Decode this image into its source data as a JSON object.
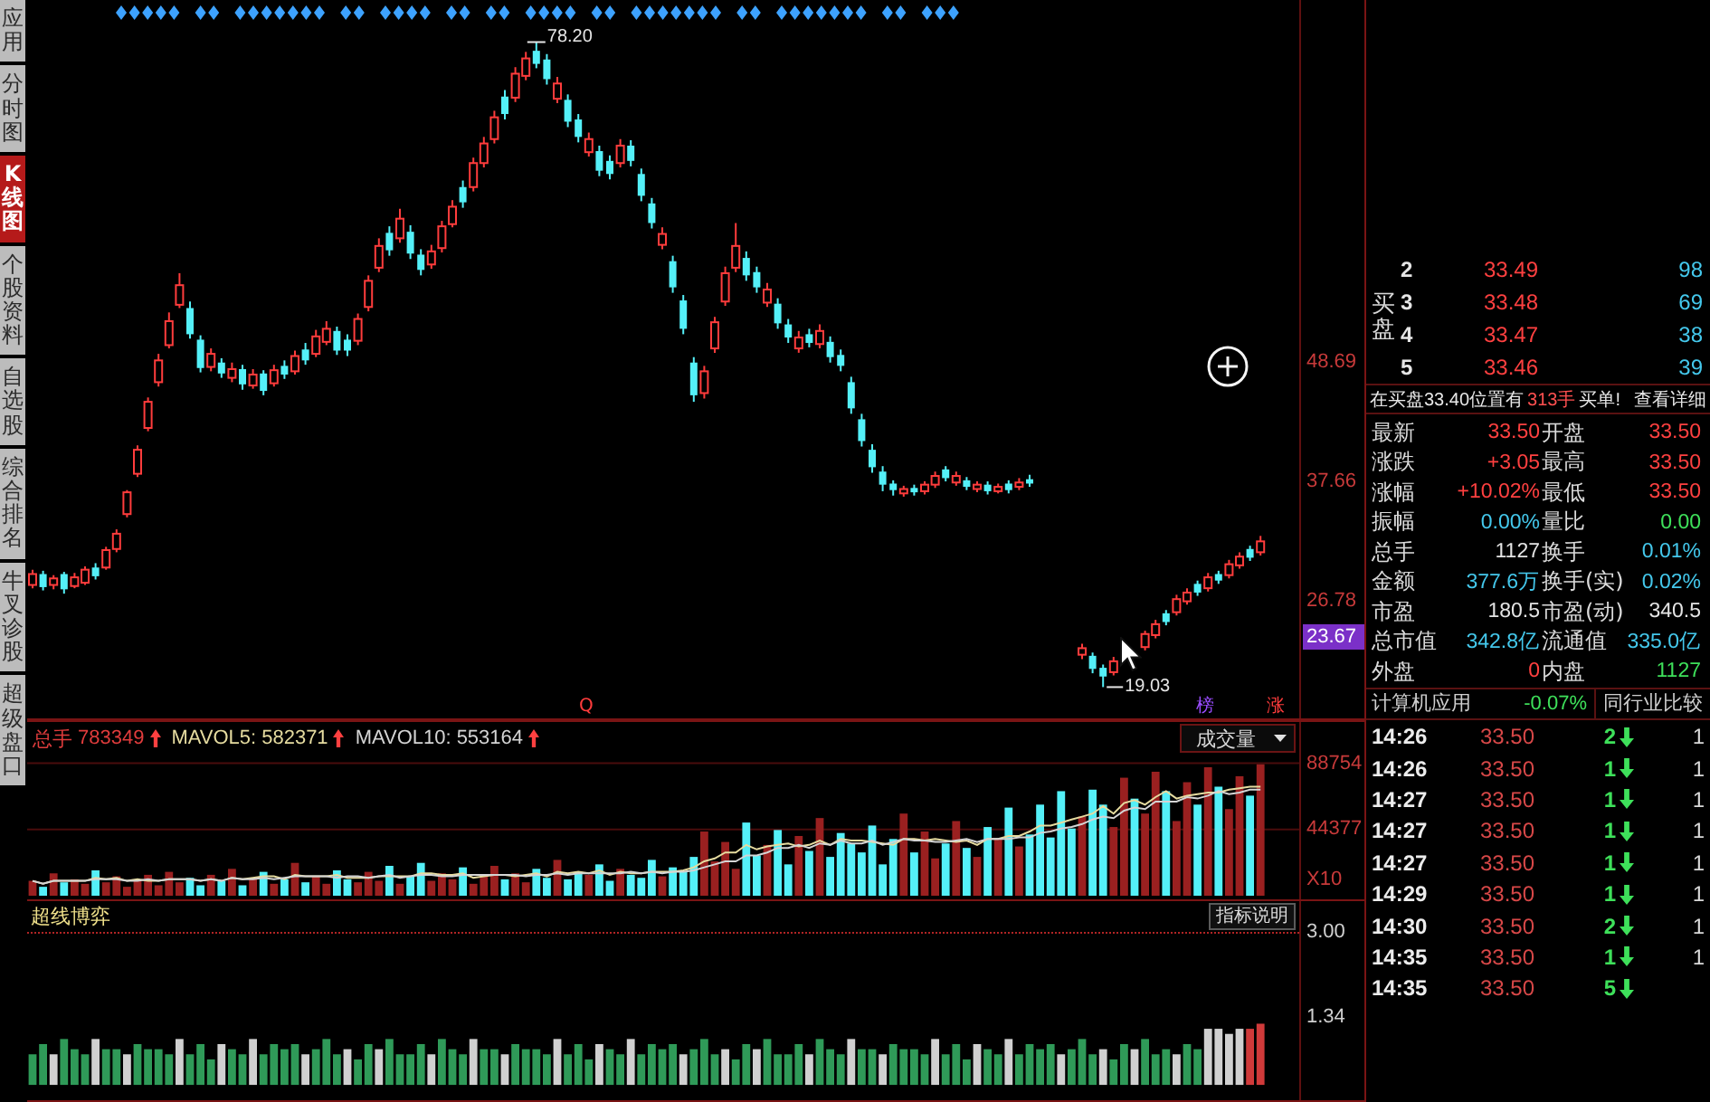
{
  "sidebar": {
    "tabs": [
      {
        "label": "应用",
        "selected": false
      },
      {
        "label": "分时图",
        "selected": false
      },
      {
        "label": "K线图",
        "selected": true
      },
      {
        "label": "个股资料",
        "selected": false
      },
      {
        "label": "自选股",
        "selected": false
      },
      {
        "label": "综合排名",
        "selected": false
      },
      {
        "label": "牛叉诊股",
        "selected": false
      },
      {
        "label": "超级盘口",
        "selected": false
      }
    ]
  },
  "price_chart": {
    "high_label": "78.20",
    "low_label": "19.03",
    "markers": [
      {
        "text": "Q",
        "color": "#ff3c3c"
      },
      {
        "text": "榜",
        "color": "#9a4cff"
      },
      {
        "text": "涨",
        "color": "#ff3c3c"
      }
    ],
    "current_tag": "23.67",
    "chart_data": {
      "type": "candlestick",
      "ylim": [
        16.16,
        82.06
      ],
      "yticks": [
        {
          "value": 48.69,
          "label": "48.69"
        },
        {
          "value": 37.66,
          "label": "37.66"
        },
        {
          "value": 26.78,
          "label": "26.78"
        }
      ],
      "ohlc": [
        [
          28.4,
          29.8,
          28.1,
          29.4
        ],
        [
          29.4,
          29.7,
          27.9,
          28.2
        ],
        [
          28.4,
          29.3,
          28.0,
          29.0
        ],
        [
          29.4,
          29.6,
          27.6,
          28.0
        ],
        [
          28.3,
          29.5,
          28.1,
          29.1
        ],
        [
          28.6,
          30.1,
          28.4,
          29.8
        ],
        [
          30.0,
          30.4,
          28.9,
          29.2
        ],
        [
          30.0,
          31.9,
          29.8,
          31.6
        ],
        [
          31.7,
          33.5,
          31.4,
          33.1
        ],
        [
          34.9,
          37.1,
          34.6,
          36.9
        ],
        [
          38.6,
          41.2,
          38.3,
          40.8
        ],
        [
          42.8,
          45.6,
          42.5,
          45.2
        ],
        [
          47.0,
          49.6,
          46.6,
          49.0
        ],
        [
          50.4,
          53.4,
          50.1,
          52.6
        ],
        [
          54.1,
          57.0,
          53.8,
          55.9
        ],
        [
          53.8,
          54.4,
          51.0,
          51.4
        ],
        [
          50.9,
          51.3,
          47.9,
          48.3
        ],
        [
          48.4,
          50.1,
          48.0,
          49.6
        ],
        [
          48.8,
          49.2,
          47.4,
          47.8
        ],
        [
          47.4,
          48.8,
          47.0,
          48.2
        ],
        [
          48.2,
          48.6,
          46.3,
          46.8
        ],
        [
          46.7,
          48.2,
          46.4,
          47.7
        ],
        [
          47.8,
          48.1,
          45.8,
          46.2
        ],
        [
          46.9,
          48.6,
          46.6,
          48.1
        ],
        [
          48.5,
          49.0,
          47.3,
          47.7
        ],
        [
          48.0,
          49.9,
          47.7,
          49.4
        ],
        [
          50.0,
          50.6,
          48.6,
          49.0
        ],
        [
          49.6,
          51.8,
          49.3,
          51.2
        ],
        [
          50.7,
          52.6,
          50.4,
          51.9
        ],
        [
          51.7,
          52.1,
          49.5,
          49.9
        ],
        [
          50.9,
          51.4,
          49.4,
          49.9
        ],
        [
          50.8,
          53.3,
          50.4,
          52.8
        ],
        [
          53.9,
          56.8,
          53.5,
          56.3
        ],
        [
          57.5,
          60.2,
          57.1,
          59.5
        ],
        [
          60.7,
          61.3,
          58.6,
          59.1
        ],
        [
          60.2,
          62.9,
          59.8,
          62.0
        ],
        [
          60.8,
          61.4,
          58.3,
          58.8
        ],
        [
          58.7,
          59.2,
          56.8,
          57.3
        ],
        [
          57.8,
          59.6,
          57.4,
          59.0
        ],
        [
          59.3,
          61.8,
          58.9,
          61.3
        ],
        [
          61.5,
          63.7,
          61.2,
          63.1
        ],
        [
          64.9,
          65.5,
          63.0,
          63.5
        ],
        [
          64.9,
          67.6,
          64.5,
          67.1
        ],
        [
          67.1,
          69.5,
          66.7,
          68.9
        ],
        [
          69.3,
          71.9,
          68.9,
          71.3
        ],
        [
          73.2,
          73.8,
          71.1,
          71.6
        ],
        [
          73.1,
          75.9,
          72.7,
          75.3
        ],
        [
          75.1,
          77.3,
          74.7,
          76.7
        ],
        [
          77.4,
          78.2,
          75.8,
          76.2
        ],
        [
          76.6,
          77.1,
          74.3,
          74.8
        ],
        [
          73.0,
          75.0,
          72.6,
          74.4
        ],
        [
          72.9,
          73.4,
          70.4,
          70.9
        ],
        [
          71.1,
          71.6,
          69.0,
          69.5
        ],
        [
          68.1,
          69.9,
          67.7,
          69.3
        ],
        [
          68.2,
          68.7,
          65.9,
          66.4
        ],
        [
          67.3,
          67.8,
          65.6,
          66.1
        ],
        [
          67.1,
          69.3,
          66.7,
          68.7
        ],
        [
          68.7,
          69.2,
          66.8,
          67.3
        ],
        [
          66.1,
          66.6,
          63.6,
          64.1
        ],
        [
          63.4,
          63.9,
          61.1,
          61.6
        ],
        [
          59.6,
          61.2,
          59.2,
          60.6
        ],
        [
          58.1,
          58.6,
          55.2,
          55.7
        ],
        [
          54.5,
          55.0,
          51.4,
          51.9
        ],
        [
          48.8,
          49.3,
          45.2,
          45.8
        ],
        [
          46.0,
          48.5,
          45.5,
          48.0
        ],
        [
          50.1,
          53.0,
          49.7,
          52.5
        ],
        [
          54.4,
          57.6,
          54.0,
          57.0
        ],
        [
          57.5,
          61.6,
          57.1,
          59.5
        ],
        [
          58.4,
          59.0,
          56.3,
          56.8
        ],
        [
          57.1,
          57.6,
          55.2,
          55.7
        ],
        [
          54.3,
          56.1,
          53.9,
          55.5
        ],
        [
          54.2,
          54.7,
          51.9,
          52.4
        ],
        [
          52.3,
          52.8,
          50.6,
          51.1
        ],
        [
          50.1,
          51.7,
          49.7,
          51.1
        ],
        [
          51.4,
          51.9,
          50.2,
          50.6
        ],
        [
          50.5,
          52.3,
          50.1,
          51.7
        ],
        [
          50.7,
          51.2,
          48.8,
          49.3
        ],
        [
          49.5,
          50.0,
          48.0,
          48.5
        ],
        [
          47.0,
          47.5,
          44.1,
          44.6
        ],
        [
          43.6,
          44.1,
          41.1,
          41.6
        ],
        [
          40.8,
          41.3,
          38.7,
          39.2
        ],
        [
          38.8,
          39.3,
          37.0,
          37.6
        ],
        [
          37.7,
          38.0,
          36.6,
          37.1
        ],
        [
          36.8,
          37.5,
          36.5,
          37.2
        ],
        [
          37.3,
          37.6,
          36.6,
          36.9
        ],
        [
          37.0,
          37.9,
          36.7,
          37.6
        ],
        [
          37.6,
          38.8,
          37.3,
          38.4
        ],
        [
          39.0,
          39.3,
          37.9,
          38.2
        ],
        [
          37.8,
          38.8,
          37.5,
          38.4
        ],
        [
          38.0,
          38.3,
          37.1,
          37.4
        ],
        [
          37.2,
          37.9,
          36.9,
          37.6
        ],
        [
          37.6,
          37.9,
          36.7,
          37.0
        ],
        [
          37.0,
          37.7,
          36.8,
          37.4
        ],
        [
          37.7,
          38.0,
          36.8,
          37.1
        ],
        [
          37.4,
          38.2,
          37.1,
          37.8
        ],
        [
          38.1,
          38.5,
          37.4,
          37.7
        ],
        null,
        null,
        null,
        null,
        [
          22.0,
          23.0,
          21.6,
          22.6
        ],
        [
          21.9,
          22.2,
          20.3,
          20.7
        ],
        [
          20.8,
          21.1,
          19.03,
          20.0
        ],
        [
          20.4,
          21.8,
          20.1,
          21.4
        ],
        null,
        null,
        [
          22.7,
          24.2,
          22.4,
          23.9
        ],
        [
          23.8,
          25.2,
          23.5,
          24.8
        ],
        [
          25.8,
          26.1,
          24.7,
          25.0
        ],
        [
          25.9,
          27.5,
          25.6,
          27.1
        ],
        [
          26.9,
          28.1,
          26.6,
          27.7
        ],
        [
          28.5,
          28.8,
          27.4,
          27.7
        ],
        [
          28.1,
          29.5,
          27.8,
          29.1
        ],
        [
          29.4,
          29.7,
          28.5,
          28.8
        ],
        [
          29.3,
          30.7,
          29.0,
          30.3
        ],
        [
          30.2,
          31.4,
          29.9,
          31.0
        ],
        [
          31.7,
          32.0,
          30.6,
          30.9
        ],
        [
          31.4,
          32.9,
          31.1,
          32.4
        ]
      ]
    }
  },
  "volume_panel": {
    "stats": [
      {
        "label": "总手",
        "value": "783349",
        "up": true,
        "color": "#e03c3c"
      },
      {
        "label": "MAVOL5:",
        "value": "582371",
        "up": true,
        "color": "#e6dca0"
      },
      {
        "label": "MAVOL10:",
        "value": "553164",
        "up": true,
        "color": "#d4d4d4"
      }
    ],
    "selector": "成交量",
    "axis_unit": "X10",
    "chart_data": {
      "type": "bar",
      "ylim": [
        -2400,
        117500
      ],
      "yticks": [
        {
          "value": 88754,
          "label": "88754"
        },
        {
          "value": 44377,
          "label": "44377"
        }
      ],
      "series": [
        {
          "type": "bar",
          "values": [
            10000,
            6000,
            15000,
            9000,
            11000,
            8000,
            17000,
            9000,
            13000,
            6000,
            10000,
            14000,
            7000,
            16000,
            9000,
            12000,
            7000,
            14000,
            10000,
            18000,
            7000,
            12000,
            16000,
            8000,
            11000,
            22000,
            9000,
            13000,
            8000,
            17000,
            11000,
            9000,
            16000,
            10000,
            20000,
            8000,
            13000,
            22000,
            10000,
            15000,
            11000,
            19000,
            8000,
            13000,
            20000,
            11000,
            15000,
            9000,
            18000,
            12000,
            24000,
            11000,
            16000,
            14000,
            21000,
            10000,
            18000,
            14000,
            12000,
            24000,
            13000,
            19000,
            16000,
            26000,
            43000,
            23000,
            36000,
            18000,
            49000,
            27000,
            34000,
            44000,
            21000,
            40000,
            30000,
            52000,
            26000,
            42000,
            35000,
            29000,
            47000,
            21000,
            38000,
            55000,
            29000,
            43000,
            25000,
            35000,
            50000,
            32000,
            26000,
            46000,
            38000,
            59000,
            33000,
            41000,
            61000,
            39000,
            70000,
            45000,
            53000,
            71000,
            61000,
            46000,
            79000,
            65000,
            55000,
            83000,
            70000,
            50000,
            76000,
            61000,
            86000,
            73000,
            58000,
            80000,
            67000,
            88000
          ],
          "colors": [
            "#9a2020",
            "#54f0f8",
            "#9a2020",
            "#54f0f8",
            "#9a2020",
            "#9a2020",
            "#54f0f8",
            "#9a2020",
            "#9a2020",
            "#9a2020",
            "#9a2020",
            "#9a2020",
            "#9a2020",
            "#9a2020",
            "#9a2020",
            "#54f0f8",
            "#54f0f8",
            "#9a2020",
            "#54f0f8",
            "#9a2020",
            "#54f0f8",
            "#9a2020",
            "#54f0f8",
            "#9a2020",
            "#54f0f8",
            "#9a2020",
            "#54f0f8",
            "#9a2020",
            "#9a2020",
            "#54f0f8",
            "#54f0f8",
            "#9a2020",
            "#9a2020",
            "#9a2020",
            "#54f0f8",
            "#9a2020",
            "#54f0f8",
            "#54f0f8",
            "#9a2020",
            "#9a2020",
            "#9a2020",
            "#54f0f8",
            "#9a2020",
            "#9a2020",
            "#9a2020",
            "#54f0f8",
            "#9a2020",
            "#9a2020",
            "#54f0f8",
            "#54f0f8",
            "#9a2020",
            "#54f0f8",
            "#54f0f8",
            "#9a2020",
            "#54f0f8",
            "#54f0f8",
            "#9a2020",
            "#54f0f8",
            "#54f0f8",
            "#54f0f8",
            "#9a2020",
            "#54f0f8",
            "#54f0f8",
            "#54f0f8",
            "#9a2020",
            "#9a2020",
            "#9a2020",
            "#9a2020",
            "#54f0f8",
            "#54f0f8",
            "#9a2020",
            "#54f0f8",
            "#54f0f8",
            "#9a2020",
            "#54f0f8",
            "#9a2020",
            "#54f0f8",
            "#54f0f8",
            "#54f0f8",
            "#54f0f8",
            "#54f0f8",
            "#54f0f8",
            "#54f0f8",
            "#9a2020",
            "#54f0f8",
            "#9a2020",
            "#9a2020",
            "#54f0f8",
            "#9a2020",
            "#54f0f8",
            "#9a2020",
            "#54f0f8",
            "#9a2020",
            "#54f0f8",
            "#9a2020",
            "#54f0f8",
            "#54f0f8",
            "#54f0f8",
            "#54f0f8",
            "#54f0f8",
            "#9a2020",
            "#54f0f8",
            "#54f0f8",
            "#9a2020",
            "#9a2020",
            "#54f0f8",
            "#9a2020",
            "#9a2020",
            "#54f0f8",
            "#9a2020",
            "#9a2020",
            "#54f0f8",
            "#9a2020",
            "#54f0f8",
            "#9a2020",
            "#9a2020",
            "#54f0f8",
            "#9a2020"
          ]
        },
        {
          "type": "line",
          "color": "#e6dca0",
          "values": [
            10000,
            8000,
            10000,
            10000,
            10000,
            10000,
            12000,
            11000,
            12000,
            10000,
            11000,
            10000,
            10000,
            11000,
            11000,
            11000,
            10000,
            11000,
            10000,
            12000,
            11000,
            12000,
            13000,
            13000,
            11000,
            14000,
            13000,
            13000,
            13000,
            14000,
            12000,
            12000,
            12000,
            13000,
            13000,
            13000,
            13000,
            15000,
            15000,
            14000,
            14000,
            15000,
            12000,
            13000,
            14000,
            14000,
            13000,
            14000,
            15000,
            13000,
            16000,
            15000,
            16000,
            15000,
            17000,
            14000,
            16000,
            15000,
            15000,
            16000,
            16000,
            16000,
            17000,
            19000,
            23000,
            25000,
            29000,
            29000,
            34000,
            31000,
            33000,
            34000,
            35000,
            33000,
            34000,
            37000,
            34000,
            38000,
            37000,
            37000,
            36000,
            35000,
            34000,
            38000,
            38000,
            37000,
            38000,
            37000,
            36000,
            37000,
            34000,
            38000,
            38000,
            40000,
            40000,
            43000,
            47000,
            47000,
            49000,
            51000,
            53000,
            55000,
            60000,
            55000,
            62000,
            64000,
            61000,
            66000,
            70000,
            65000,
            67000,
            68000,
            69000,
            69000,
            71000,
            72000,
            73000,
            73000
          ]
        },
        {
          "type": "line",
          "color": "#d4d4d4",
          "values": [
            10000,
            8000,
            10000,
            10000,
            10000,
            10000,
            11000,
            11000,
            11000,
            10000,
            10000,
            11000,
            10000,
            11000,
            11000,
            11000,
            10000,
            11000,
            10000,
            12000,
            11000,
            11000,
            12000,
            11000,
            12000,
            13000,
            13000,
            13000,
            13000,
            12000,
            13000,
            13000,
            12000,
            13000,
            14000,
            12000,
            13000,
            14000,
            14000,
            13000,
            13000,
            14000,
            14000,
            14000,
            14000,
            14000,
            14000,
            13000,
            14000,
            14000,
            15000,
            14000,
            15000,
            15000,
            15000,
            15000,
            15000,
            16000,
            15000,
            16000,
            15000,
            16000,
            16000,
            17000,
            19000,
            21000,
            23000,
            23000,
            27000,
            27000,
            29000,
            32000,
            32000,
            34000,
            32000,
            35000,
            34000,
            37000,
            35000,
            35000,
            37000,
            34000,
            36000,
            38000,
            37000,
            37000,
            36000,
            36000,
            37000,
            38000,
            36000,
            38000,
            38000,
            38000,
            39000,
            39000,
            42000,
            43000,
            45000,
            46000,
            48000,
            51000,
            53000,
            52000,
            57000,
            59000,
            58000,
            63000,
            63000,
            63000,
            66000,
            65000,
            67000,
            70000,
            68000,
            69000,
            71000,
            71000
          ]
        }
      ]
    }
  },
  "indicator_panel": {
    "name": "超线博弈",
    "help_button": "指标说明",
    "chart_data": {
      "type": "bar",
      "ylim": [
        -0.3,
        3.0
      ],
      "yticks": [
        {
          "value": 3.0,
          "label": "3.00"
        },
        {
          "value": 1.34,
          "label": "1.34"
        }
      ],
      "series": [
        {
          "values": [
            0.6,
            0.8,
            0.6,
            0.9,
            0.7,
            0.6,
            0.9,
            0.7,
            0.7,
            0.6,
            0.8,
            0.7,
            0.7,
            0.6,
            0.9,
            0.6,
            0.8,
            0.5,
            0.8,
            0.7,
            0.6,
            0.9,
            0.6,
            0.8,
            0.7,
            0.8,
            0.6,
            0.7,
            0.9,
            0.6,
            0.7,
            0.5,
            0.8,
            0.7,
            0.9,
            0.6,
            0.6,
            0.8,
            0.6,
            0.9,
            0.7,
            0.6,
            0.9,
            0.7,
            0.7,
            0.6,
            0.8,
            0.7,
            0.7,
            0.6,
            0.9,
            0.6,
            0.8,
            0.5,
            0.8,
            0.7,
            0.6,
            0.9,
            0.6,
            0.8,
            0.7,
            0.8,
            0.6,
            0.7,
            0.9,
            0.6,
            0.7,
            0.5,
            0.8,
            0.7,
            0.9,
            0.6,
            0.6,
            0.8,
            0.6,
            0.9,
            0.7,
            0.6,
            0.9,
            0.7,
            0.7,
            0.6,
            0.8,
            0.7,
            0.7,
            0.6,
            0.9,
            0.6,
            0.8,
            0.5,
            0.8,
            0.7,
            0.6,
            0.9,
            0.6,
            0.8,
            0.7,
            0.8,
            0.6,
            0.7,
            0.9,
            0.6,
            0.7,
            0.5,
            0.8,
            0.7,
            0.9,
            0.6,
            0.7,
            0.6,
            0.8,
            0.7,
            1.1,
            1.1,
            1.0,
            1.1,
            1.1,
            1.2
          ],
          "colors": [
            "#2f9a58",
            "#2f9a58",
            "#d0d0d0",
            "#2f9a58",
            "#2f9a58",
            "#2f9a58",
            "#d0d0d0",
            "#2f9a58",
            "#2f9a58",
            "#d0d0d0",
            "#2f9a58",
            "#2f9a58",
            "#2f9a58",
            "#2f9a58",
            "#d0d0d0",
            "#2f9a58",
            "#2f9a58",
            "#2f9a58",
            "#d0d0d0",
            "#2f9a58",
            "#2f9a58",
            "#d0d0d0",
            "#2f9a58",
            "#2f9a58",
            "#2f9a58",
            "#2f9a58",
            "#d0d0d0",
            "#2f9a58",
            "#2f9a58",
            "#2f9a58",
            "#d0d0d0",
            "#2f9a58",
            "#2f9a58",
            "#d0d0d0",
            "#2f9a58",
            "#2f9a58",
            "#2f9a58",
            "#2f9a58",
            "#d0d0d0",
            "#2f9a58",
            "#2f9a58",
            "#2f9a58",
            "#d0d0d0",
            "#2f9a58",
            "#2f9a58",
            "#d0d0d0",
            "#2f9a58",
            "#2f9a58",
            "#2f9a58",
            "#2f9a58",
            "#d0d0d0",
            "#2f9a58",
            "#2f9a58",
            "#2f9a58",
            "#d0d0d0",
            "#2f9a58",
            "#2f9a58",
            "#d0d0d0",
            "#2f9a58",
            "#2f9a58",
            "#2f9a58",
            "#2f9a58",
            "#d0d0d0",
            "#2f9a58",
            "#2f9a58",
            "#2f9a58",
            "#d0d0d0",
            "#2f9a58",
            "#2f9a58",
            "#d0d0d0",
            "#2f9a58",
            "#2f9a58",
            "#2f9a58",
            "#2f9a58",
            "#d0d0d0",
            "#2f9a58",
            "#2f9a58",
            "#2f9a58",
            "#d0d0d0",
            "#2f9a58",
            "#2f9a58",
            "#d0d0d0",
            "#2f9a58",
            "#2f9a58",
            "#2f9a58",
            "#2f9a58",
            "#d0d0d0",
            "#2f9a58",
            "#2f9a58",
            "#2f9a58",
            "#d0d0d0",
            "#2f9a58",
            "#2f9a58",
            "#d0d0d0",
            "#2f9a58",
            "#2f9a58",
            "#2f9a58",
            "#2f9a58",
            "#d0d0d0",
            "#2f9a58",
            "#2f9a58",
            "#2f9a58",
            "#d0d0d0",
            "#2f9a58",
            "#2f9a58",
            "#d0d0d0",
            "#2f9a58",
            "#2f9a58",
            "#2f9a58",
            "#d0d0d0",
            "#2f9a58",
            "#2f9a58",
            "#d0d0d0",
            "#d0d0d0",
            "#d0d0d0",
            "#d0d0d0",
            "#d03a3a",
            "#d03a3a"
          ]
        }
      ]
    }
  },
  "order_book": {
    "side_label": "买盘",
    "rows": [
      {
        "rank": "2",
        "price": "33.49",
        "volume": "98"
      },
      {
        "rank": "3",
        "price": "33.48",
        "volume": "69"
      },
      {
        "rank": "4",
        "price": "33.47",
        "volume": "38"
      },
      {
        "rank": "5",
        "price": "33.46",
        "volume": "39"
      }
    ]
  },
  "order_notice": {
    "text": "在买盘33.40位置有",
    "lots": "313手",
    "suffix": "买单!",
    "link": "查看详细"
  },
  "quote": {
    "rows": [
      {
        "left": {
          "label": "最新",
          "value": "33.50",
          "color": "#ff4040"
        },
        "right": {
          "label": "开盘",
          "value": "33.50",
          "color": "#ff4040"
        }
      },
      {
        "left": {
          "label": "涨跌",
          "value": "+3.05",
          "color": "#ff4040"
        },
        "right": {
          "label": "最高",
          "value": "33.50",
          "color": "#ff4040"
        }
      },
      {
        "left": {
          "label": "涨幅",
          "value": "+10.02%",
          "color": "#ff4040"
        },
        "right": {
          "label": "最低",
          "value": "33.50",
          "color": "#ff4040"
        }
      },
      {
        "left": {
          "label": "振幅",
          "value": "0.00%",
          "color": "#44c8ec"
        },
        "right": {
          "label": "量比",
          "value": "0.00",
          "color": "#3ee05a"
        }
      },
      {
        "left": {
          "label": "总手",
          "value": "1127",
          "color": "#e4e4e4"
        },
        "right": {
          "label": "换手",
          "value": "0.01%",
          "color": "#44c8ec"
        }
      },
      {
        "left": {
          "label": "金额",
          "value": "377.6万",
          "color": "#44c8ec"
        },
        "right": {
          "label": "换手(实)",
          "value": "0.02%",
          "color": "#44c8ec"
        }
      },
      {
        "left": {
          "label": "市盈",
          "value": "180.5",
          "color": "#e4e4e4"
        },
        "right": {
          "label": "市盈(动)",
          "value": "340.5",
          "color": "#e4e4e4"
        }
      },
      {
        "left": {
          "label": "总市值",
          "value": "342.8亿",
          "color": "#44c8ec"
        },
        "right": {
          "label": "流通值",
          "value": "335.0亿",
          "color": "#44c8ec"
        }
      },
      {
        "left": {
          "label": "外盘",
          "value": "0",
          "color": "#ff4040"
        },
        "right": {
          "label": "内盘",
          "value": "1127",
          "color": "#3ee05a"
        }
      }
    ]
  },
  "sector": {
    "name": "计算机应用",
    "change": "-0.07%",
    "up": false,
    "compare_button": "同行业比较"
  },
  "trades": [
    {
      "time": "14:26",
      "price": "33.50",
      "volume": "2",
      "up": false,
      "column_4": "1"
    },
    {
      "time": "14:26",
      "price": "33.50",
      "volume": "1",
      "up": false,
      "column_4": "1"
    },
    {
      "time": "14:27",
      "price": "33.50",
      "volume": "1",
      "up": false,
      "column_4": "1"
    },
    {
      "time": "14:27",
      "price": "33.50",
      "volume": "1",
      "up": false,
      "column_4": "1"
    },
    {
      "time": "14:27",
      "price": "33.50",
      "volume": "1",
      "up": false,
      "column_4": "1"
    },
    {
      "time": "14:29",
      "price": "33.50",
      "volume": "1",
      "up": false,
      "column_4": "1"
    },
    {
      "time": "14:30",
      "price": "33.50",
      "volume": "2",
      "up": false,
      "column_4": "1"
    },
    {
      "time": "14:35",
      "price": "33.50",
      "volume": "1",
      "up": false,
      "column_4": "1"
    },
    {
      "time": "14:35",
      "price": "33.50",
      "volume": "5",
      "up": false
    }
  ]
}
